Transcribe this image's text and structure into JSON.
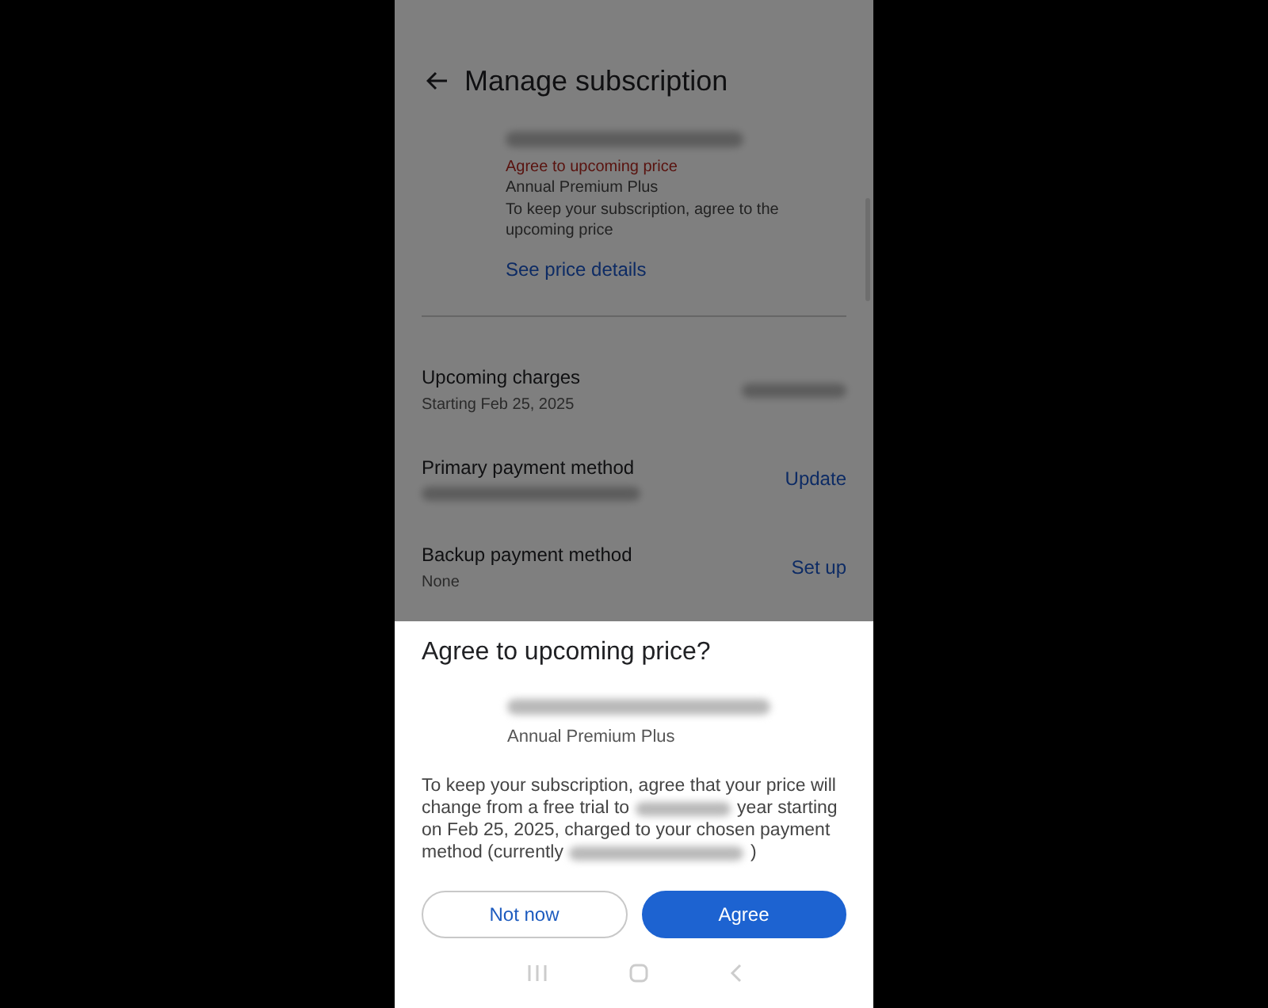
{
  "header": {
    "title": "Manage subscription"
  },
  "subscription": {
    "status": "Agree to upcoming price",
    "plan": "Annual Premium Plus",
    "note": "To keep your subscription, agree to the upcoming price",
    "link": "See price details"
  },
  "rows": [
    {
      "kind": "amount",
      "title": "Upcoming charges",
      "subtitle": "Starting Feb 25, 2025"
    },
    {
      "kind": "hidden_detail",
      "title": "Primary payment method",
      "action": "Update"
    },
    {
      "kind": "plain",
      "title": "Backup payment method",
      "subtitle": "None",
      "action": "Set up"
    }
  ],
  "sheet": {
    "title": "Agree to upcoming price?",
    "plan": "Annual Premium Plus",
    "message": [
      [
        {
          "kind": "text",
          "text": "To keep your subscription, agree that your price will"
        }
      ],
      [
        {
          "kind": "text",
          "text": "change from a free trial to"
        },
        {
          "kind": "blurred"
        },
        {
          "kind": "text",
          "text": "year starting"
        }
      ],
      [
        {
          "kind": "text",
          "text": "on Feb 25, 2025, charged to your chosen payment"
        }
      ],
      [
        {
          "kind": "text",
          "text": "method (currently"
        },
        {
          "kind": "blurred"
        },
        {
          "kind": "text",
          "text": ")"
        }
      ]
    ],
    "buttons": [
      {
        "label": "Not now",
        "kind": "outlined"
      },
      {
        "label": "Agree",
        "kind": "filled"
      }
    ]
  }
}
